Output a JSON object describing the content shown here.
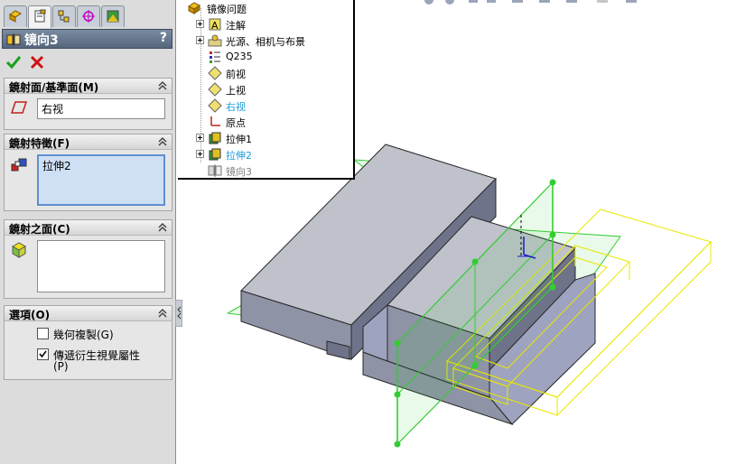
{
  "panel": {
    "title": "镜向3",
    "help_label": "?",
    "tabs": [
      "feature-manager-icon",
      "property-manager-icon",
      "configuration-manager-icon",
      "dimxpert-icon",
      "display-manager-icon"
    ],
    "mirror_face": {
      "header": "鏡射面/基準面(M)",
      "value": "右视"
    },
    "mirror_features": {
      "header": "鏡射特徵(F)",
      "items": [
        "拉伸2"
      ]
    },
    "mirror_faces": {
      "header": "鏡射之面(C)"
    },
    "options": {
      "header": "選項(O)",
      "geometry_pattern": {
        "label": "幾何複製(G)",
        "checked": false
      },
      "propagate_visual": {
        "label": "傳遞衍生視覺屬性",
        "label2": "(P)",
        "checked": true
      }
    }
  },
  "tree": {
    "root": "镜像问题",
    "items": [
      {
        "label": "注解",
        "icon": "annotation-icon",
        "expandable": true,
        "color": "#000000"
      },
      {
        "label": "光源、相机与布景",
        "icon": "lights-camera-icon",
        "expandable": true,
        "color": "#000000"
      },
      {
        "label": "Q235",
        "icon": "material-icon",
        "expandable": false,
        "color": "#000000"
      },
      {
        "label": "前视",
        "icon": "plane-icon",
        "expandable": false,
        "color": "#000000"
      },
      {
        "label": "上视",
        "icon": "plane-icon",
        "expandable": false,
        "color": "#000000"
      },
      {
        "label": "右视",
        "icon": "plane-icon",
        "expandable": false,
        "color": "#1e9bd7"
      },
      {
        "label": "原点",
        "icon": "origin-icon",
        "expandable": false,
        "color": "#000000"
      },
      {
        "label": "拉伸1",
        "icon": "extrude-icon",
        "expandable": true,
        "color": "#000000"
      },
      {
        "label": "拉伸2",
        "icon": "extrude-icon",
        "expandable": true,
        "color": "#1e9bd7"
      },
      {
        "label": "镜向3",
        "icon": "mirror-icon",
        "expandable": false,
        "color": "#808080"
      }
    ]
  },
  "colors": {
    "accent_blue": "#1e9bd7",
    "preview_yellow": "#e8e800",
    "plane_green": "#33cc33",
    "body_gray": "#8a8fa8"
  }
}
